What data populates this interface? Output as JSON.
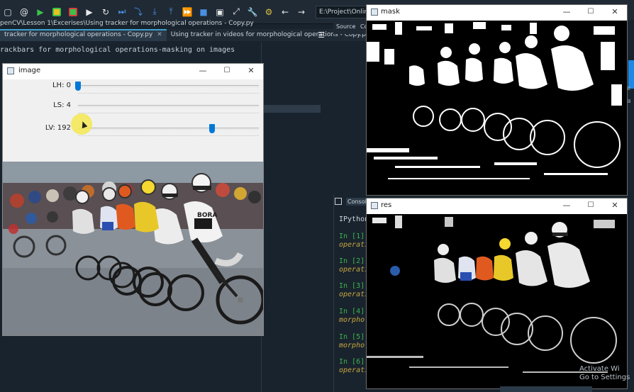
{
  "toolbar": {
    "icons": [
      "new-file-icon",
      "at-sign-icon",
      "run-icon",
      "run-cell-icon",
      "run-cell-advance-icon",
      "run-selection-icon",
      "rerun-icon",
      "debug-icon",
      "step-icon",
      "step-into-icon",
      "step-return-icon",
      "continue-icon",
      "stop-icon",
      "maximize-pane-icon",
      "fullscreen-icon",
      "preferences-icon",
      "python-icon",
      "back-icon",
      "forward-icon"
    ],
    "path": "E:\\Project\\Online Courses\\OpenCV\\"
  },
  "editor": {
    "path_line": "penCV\\Lesson 1\\Excerises\\Using tracker for morphological operations - Copy.py",
    "tabs": [
      {
        "label": "tracker for morphological operations - Copy.py",
        "active": true
      },
      {
        "label": "Using tracker in videos for morphological operations - Copy.py",
        "active": false
      }
    ],
    "code_line": "rackbars for morphological operations-masking on images"
  },
  "source_tabs": [
    "Source",
    "Co"
  ],
  "console": {
    "tab_label": "Console",
    "ipython": "IPython",
    "entries": [
      {
        "prompt": "In [1]:",
        "text": "operatio"
      },
      {
        "prompt": "In [2]:",
        "text": "operatio"
      },
      {
        "prompt": "In [3]:",
        "text": "operatio"
      },
      {
        "prompt": "In [4]:",
        "text": "morpholo"
      },
      {
        "prompt": "In [5]:",
        "text": "morpholo"
      },
      {
        "prompt": "In [6]:",
        "text": "operatio"
      }
    ]
  },
  "image_window": {
    "title": "image",
    "trackbars": [
      {
        "label": "LH: 0",
        "value": 0,
        "max": 179
      },
      {
        "label": "LS: 4",
        "value": 4,
        "max": 255
      },
      {
        "label": "LV: 192",
        "value": 192,
        "max": 255
      }
    ]
  },
  "mask_window": {
    "title": "mask"
  },
  "res_window": {
    "title": "res"
  },
  "window_buttons": {
    "minimize": "—",
    "maximize": "☐",
    "close": "✕"
  },
  "watermark": {
    "line1": "Activate Wi",
    "line2": "Go to Settings"
  },
  "right_edge": [
    "a",
    "e"
  ]
}
